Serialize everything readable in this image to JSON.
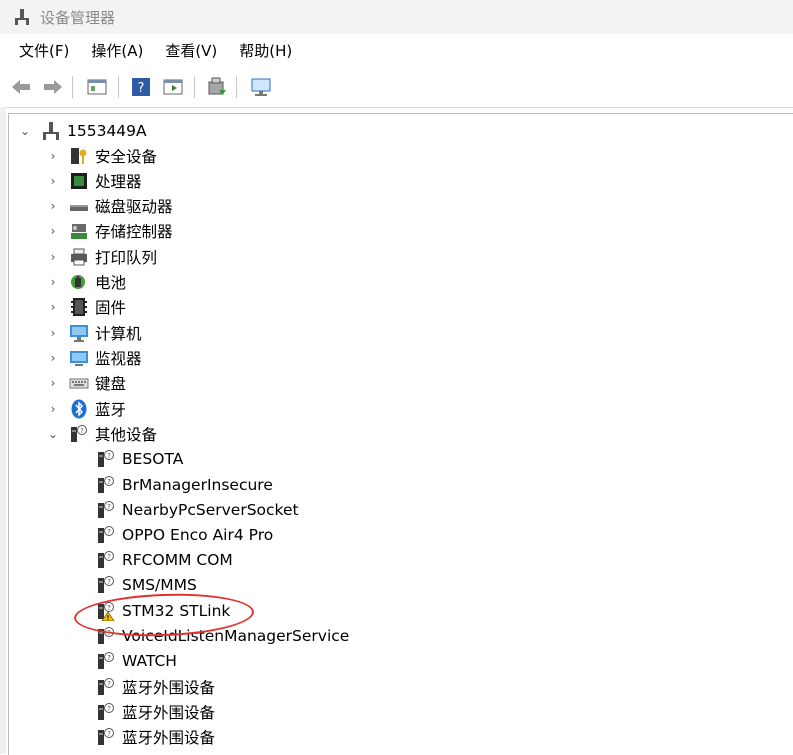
{
  "window": {
    "title": "设备管理器"
  },
  "menu": {
    "items": [
      "文件(F)",
      "操作(A)",
      "查看(V)",
      "帮助(H)"
    ]
  },
  "tree": {
    "root": "1553449A",
    "categories": [
      {
        "label": "安全设备",
        "icon": "security-device-icon",
        "expanded": false
      },
      {
        "label": "处理器",
        "icon": "processor-icon",
        "expanded": false
      },
      {
        "label": "磁盘驱动器",
        "icon": "disk-drive-icon",
        "expanded": false
      },
      {
        "label": "存储控制器",
        "icon": "storage-controller-icon",
        "expanded": false
      },
      {
        "label": "打印队列",
        "icon": "printer-icon",
        "expanded": false
      },
      {
        "label": "电池",
        "icon": "battery-icon",
        "expanded": false
      },
      {
        "label": "固件",
        "icon": "firmware-icon",
        "expanded": false
      },
      {
        "label": "计算机",
        "icon": "computer-icon",
        "expanded": false
      },
      {
        "label": "监视器",
        "icon": "monitor-icon",
        "expanded": false
      },
      {
        "label": "键盘",
        "icon": "keyboard-icon",
        "expanded": false
      },
      {
        "label": "蓝牙",
        "icon": "bluetooth-icon",
        "expanded": false
      },
      {
        "label": "其他设备",
        "icon": "unknown-device-icon",
        "expanded": true
      }
    ],
    "other_devices": [
      {
        "label": "BESOTA",
        "warning": false
      },
      {
        "label": "BrManagerInsecure",
        "warning": false
      },
      {
        "label": "NearbyPcServerSocket",
        "warning": false
      },
      {
        "label": "OPPO Enco Air4 Pro",
        "warning": false
      },
      {
        "label": "RFCOMM COM",
        "warning": false
      },
      {
        "label": "SMS/MMS",
        "warning": false
      },
      {
        "label": "STM32 STLink",
        "warning": true
      },
      {
        "label": "VoiceIdListenManagerService",
        "warning": false
      },
      {
        "label": "WATCH",
        "warning": false
      },
      {
        "label": "蓝牙外围设备",
        "warning": false
      },
      {
        "label": "蓝牙外围设备",
        "warning": false
      },
      {
        "label": "蓝牙外围设备",
        "warning": false
      }
    ]
  },
  "colors": {
    "annotation": "#e0322f",
    "warning": "#f2c200"
  }
}
